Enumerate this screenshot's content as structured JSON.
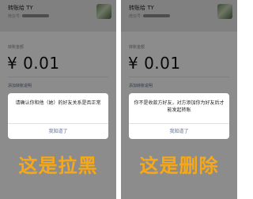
{
  "panels": [
    {
      "recipient": {
        "name": "转账给 TY",
        "sub_label": "微信号："
      },
      "transfer": {
        "amount_label": "转账金额",
        "amount": "¥ 0.01",
        "note_link": "添加转账说明"
      },
      "dialog": {
        "message": "请确认你和他（她）的好友关系是否正常",
        "button_label": "我知道了"
      },
      "caption": "这是拉黑"
    },
    {
      "recipient": {
        "name": "转账给 TY",
        "sub_label": "微信号："
      },
      "transfer": {
        "amount_label": "转账金额",
        "amount": "¥ 0.01",
        "note_link": "添加转账说明"
      },
      "dialog": {
        "message": "你不是收款方好友，对方添加你为好友后才能发起转账",
        "button_label": "我知道了"
      },
      "caption": "这是删除"
    }
  ],
  "colors": {
    "caption": "#f6a818",
    "dialog_button": "#576b95",
    "overlay": "rgba(0,0,0,0.45)"
  },
  "icons": [
    "recipient-avatar"
  ]
}
